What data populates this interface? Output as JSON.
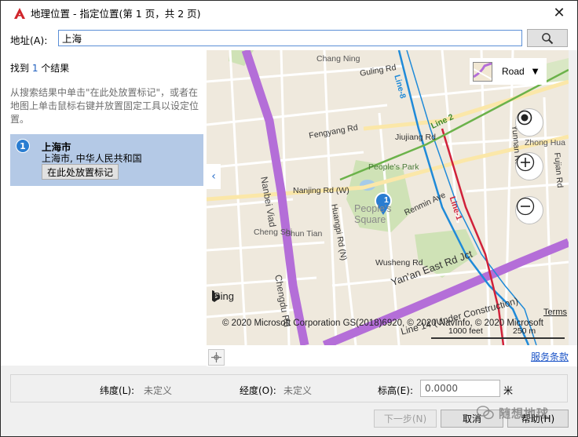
{
  "window": {
    "title": "地理位置 - 指定位置(第 1 页，共 2 页)",
    "close_glyph": "✕"
  },
  "address": {
    "label": "地址(A):",
    "value": "上海"
  },
  "results": {
    "count_prefix": "找到 ",
    "count": "1",
    "count_suffix": " 个结果",
    "hint": "从搜索结果中单击\"在此处放置标记\"，或者在地图上单击鼠标右键并放置固定工具以设定位置。",
    "items": [
      {
        "index": "1",
        "name": "上海市",
        "description": "上海市, 中华人民共和国",
        "button_label": "在此处放置标记"
      }
    ]
  },
  "map": {
    "type_label": "Road",
    "bing_label": "Bing",
    "copyright": "© 2020 Microsoft Corporation GS(2018)6920, © 2020 NavInfo, © 2020 Microsoft",
    "terms": "Terms",
    "scale_feet": "1000 feet",
    "scale_m": "250 m",
    "pin_number": "1",
    "labels": {
      "changning": "Chang Ning",
      "nanbei": "Nanbei Viad",
      "chengdu": "Chengdu Rd",
      "people_park": "People's Park",
      "people_square": "People's Square",
      "nanjing": "Nanjing Rd (W)",
      "jiujiang": "Jiujiang Rd",
      "remmin": "Renmin Ave",
      "yanan": "Yan'an East Rd Jct",
      "wusheng": "Wusheng Rd",
      "line8": "Line-8",
      "line2": "Line 2",
      "line1": "Line-1",
      "fengyang": "Fengyang Rd",
      "guling": "Guling Rd",
      "zhong_hua": "Zhong Hua",
      "shun_tian": "Shun Tian",
      "huangpi": "Huangpi Rd (N)",
      "fujian": "Fujian Rd",
      "yunnan": "Yunnan Rd",
      "cheng_shi": "Cheng Shi",
      "line14": "Line 14 (Under Construction)"
    }
  },
  "terms_link": "服务条款",
  "coords": {
    "lat_label": "纬度(L):",
    "lat_value": "未定义",
    "lon_label": "经度(O):",
    "lon_value": "未定义",
    "elev_label": "标高(E):",
    "elev_value": "0.0000",
    "elev_unit": "米"
  },
  "footer": {
    "next": "下一步(N)",
    "cancel": "取消",
    "help": "帮助(H)"
  },
  "watermark": "随想地球",
  "colors": {
    "accent": "#2a7dd1",
    "selection": "#b4c9e6",
    "link": "#1a53c7",
    "metro_blue": "#1f8ad8",
    "metro_red": "#d0213a",
    "viaduct": "#b46ed8"
  }
}
